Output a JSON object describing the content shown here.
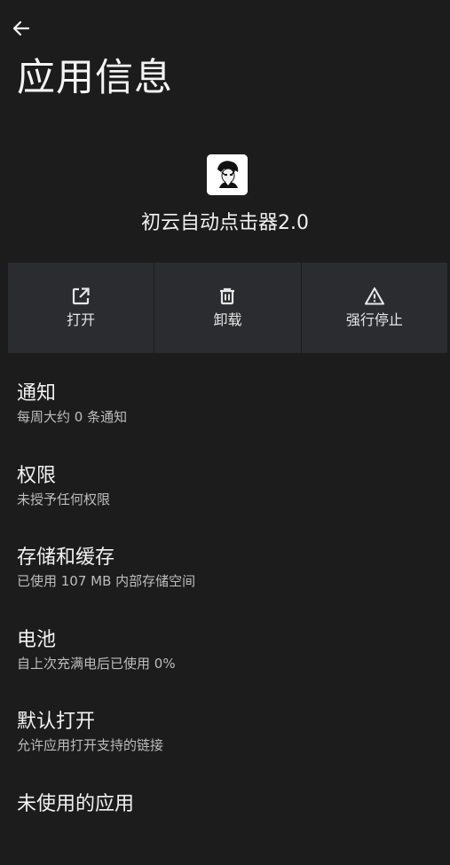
{
  "header": {
    "back_icon": "arrow-left-icon",
    "title": "应用信息"
  },
  "app": {
    "icon": "app-icon-character",
    "name": "初云自动点击器2.0"
  },
  "actions": [
    {
      "label": "打开",
      "icon": "open-external-icon"
    },
    {
      "label": "卸载",
      "icon": "trash-icon"
    },
    {
      "label": "强行停止",
      "icon": "warning-triangle-icon"
    }
  ],
  "settings": [
    {
      "title": "通知",
      "subtitle": "每周大约 0 条通知"
    },
    {
      "title": "权限",
      "subtitle": "未授予任何权限"
    },
    {
      "title": "存储和缓存",
      "subtitle": "已使用 107 MB 内部存储空间"
    },
    {
      "title": "电池",
      "subtitle": "自上次充满电后已使用 0%"
    },
    {
      "title": "默认打开",
      "subtitle": "允许应用打开支持的链接"
    },
    {
      "title": "未使用的应用"
    }
  ],
  "colors": {
    "background": "#1c1c1d",
    "action_bar": "#2b2c2f",
    "text_primary": "#f2f2f2",
    "text_secondary": "#bdbdbd"
  }
}
